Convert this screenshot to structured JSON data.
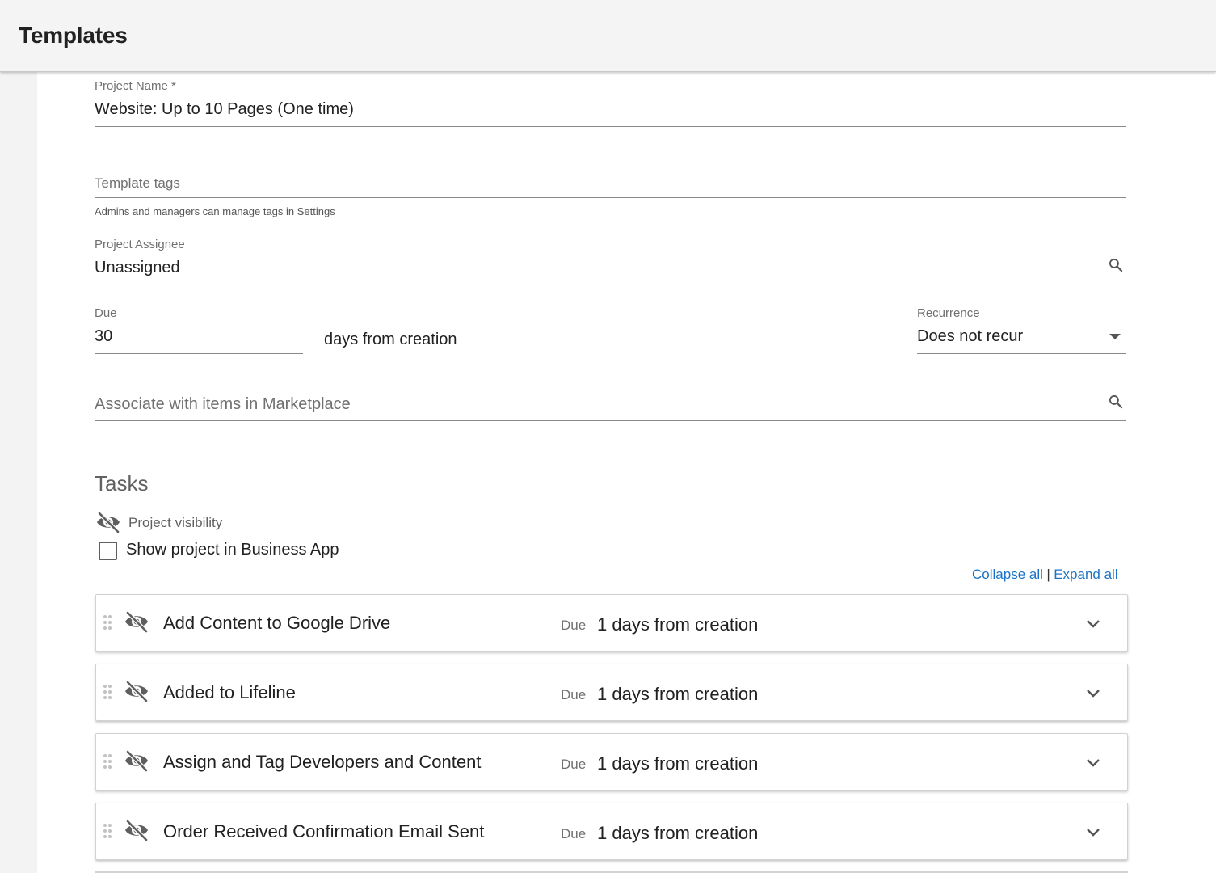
{
  "header": {
    "title": "Templates"
  },
  "form": {
    "project_name": {
      "label": "Project Name *",
      "value": "Website: Up to 10 Pages (One time)"
    },
    "template_tags": {
      "placeholder": "Template tags",
      "helper": "Admins and managers can manage tags in Settings"
    },
    "project_assignee": {
      "label": "Project Assignee",
      "value": "Unassigned",
      "icon": "search-icon"
    },
    "due": {
      "label": "Due",
      "value": "30",
      "suffix": "days from creation"
    },
    "recurrence": {
      "label": "Recurrence",
      "value": "Does not recur",
      "icon": "dropdown-arrow-icon"
    },
    "marketplace": {
      "placeholder": "Associate with items in Marketplace",
      "icon": "search-icon"
    }
  },
  "tasks": {
    "title": "Tasks",
    "visibility_label": "Project visibility",
    "visibility_icon": "eye-off-icon",
    "show_in_app_label": "Show project in Business App",
    "show_in_app_checked": false,
    "collapse_all": "Collapse all",
    "separator": "|",
    "expand_all": "Expand all",
    "items": [
      {
        "name": "Add Content to Google Drive",
        "due_label": "Due",
        "due_value": "1 days from creation"
      },
      {
        "name": "Added to Lifeline",
        "due_label": "Due",
        "due_value": "1 days from creation"
      },
      {
        "name": "Assign and Tag Developers and Content",
        "due_label": "Due",
        "due_value": "1 days from creation"
      },
      {
        "name": "Order Received Confirmation Email Sent",
        "due_label": "Due",
        "due_value": "1 days from creation"
      }
    ]
  },
  "colors": {
    "link": "#1a73c8",
    "text": "#212121",
    "muted": "#707070",
    "background": "#f3f3f3"
  }
}
